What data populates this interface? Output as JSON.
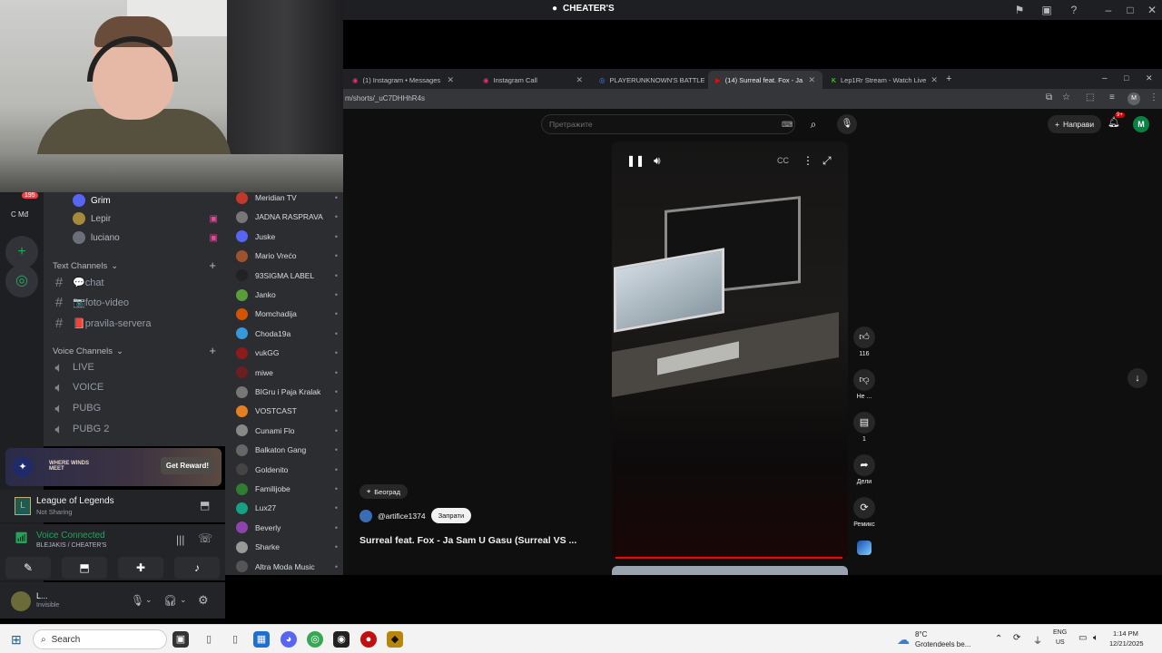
{
  "topbar": {
    "title": "CHEATER'S"
  },
  "discord": {
    "badge": "195",
    "server_short": "C Mđ",
    "voice_users": [
      "Grim",
      "Lepir",
      "luciano"
    ],
    "text_category": "Text Channels",
    "text_channels": [
      "💬chat",
      "📷foto-video",
      "📕pravila-servera"
    ],
    "voice_category": "Voice Channels",
    "voice_channels": [
      "LIVE",
      "VOICE",
      "PUBG",
      "PUBG 2"
    ],
    "members": [
      "Meridian TV",
      "JADNA RASPRAVA",
      "Juske",
      "Mario Vrećo",
      "93SIGMA LABEL",
      "Janko",
      "Momchadija",
      "Choda19a",
      "vukGG",
      "miwe",
      "BIGru i Paja Kralak",
      "VOSTCAST",
      "Cunami Flo",
      "Balkaton Gang",
      "Goldenito",
      "Familijobe",
      "Lux27",
      "Beverly",
      "Sharke",
      "Altra Moda Music"
    ],
    "promo": {
      "logo": "WHERE WINDS MEET",
      "button": "Get Reward!"
    },
    "activity": {
      "title": "League of Legends",
      "status": "Not Sharing"
    },
    "voice": {
      "status": "Voice Connected",
      "channel": "BLEJAKIS / CHEATER'S"
    },
    "user": {
      "name": "L...",
      "status": "Invisible"
    }
  },
  "browser": {
    "tabs": [
      "(1) Instagram • Messages",
      "Instagram Call",
      "PLAYERUNKNOWN'S BATTLE",
      "(14) Surreal feat. Fox - Ja",
      "Lep1Rr Stream - Watch Live"
    ],
    "url": "m/shorts/_uC7DHHhR4s"
  },
  "youtube": {
    "search_placeholder": "Претражите",
    "create_label": "Направи",
    "notif_badge": "9+",
    "avatar": "M",
    "actions": [
      {
        "icon": "thumb-up",
        "label": "116"
      },
      {
        "icon": "thumb-down",
        "label": "Не ..."
      },
      {
        "icon": "comment",
        "label": "1"
      },
      {
        "icon": "share",
        "label": "Дели"
      },
      {
        "icon": "remix",
        "label": "Ремикс"
      }
    ],
    "location": "Београд",
    "channel": "@artifice1374",
    "subscribe": "Запрати",
    "video_title": "Surreal feat. Fox - Ja Sam U Gasu (Surreal VS ..."
  },
  "taskbar": {
    "search": "Search",
    "weather_temp": "8°C",
    "weather_text": "Grotendeels be...",
    "lang1": "ENG",
    "lang2": "US",
    "time": "1:14 PM",
    "date": "12/21/2025"
  },
  "colors": {
    "discord_bg": "#2b2d31",
    "green": "#23a559",
    "youtube_red": "#ff0000"
  }
}
